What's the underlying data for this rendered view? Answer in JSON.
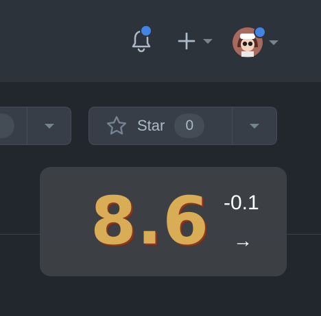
{
  "header": {
    "notifications_icon": "bell-icon",
    "notifications_dot_color": "#4184e4",
    "new_menu_icon": "plus-icon",
    "avatar_icon": "avatar"
  },
  "repo_actions": {
    "watch_count": "",
    "star": {
      "label": "Star",
      "count": "0"
    }
  },
  "score_card": {
    "score": "8.6",
    "delta": "-0.1",
    "trend_symbol": "→"
  }
}
